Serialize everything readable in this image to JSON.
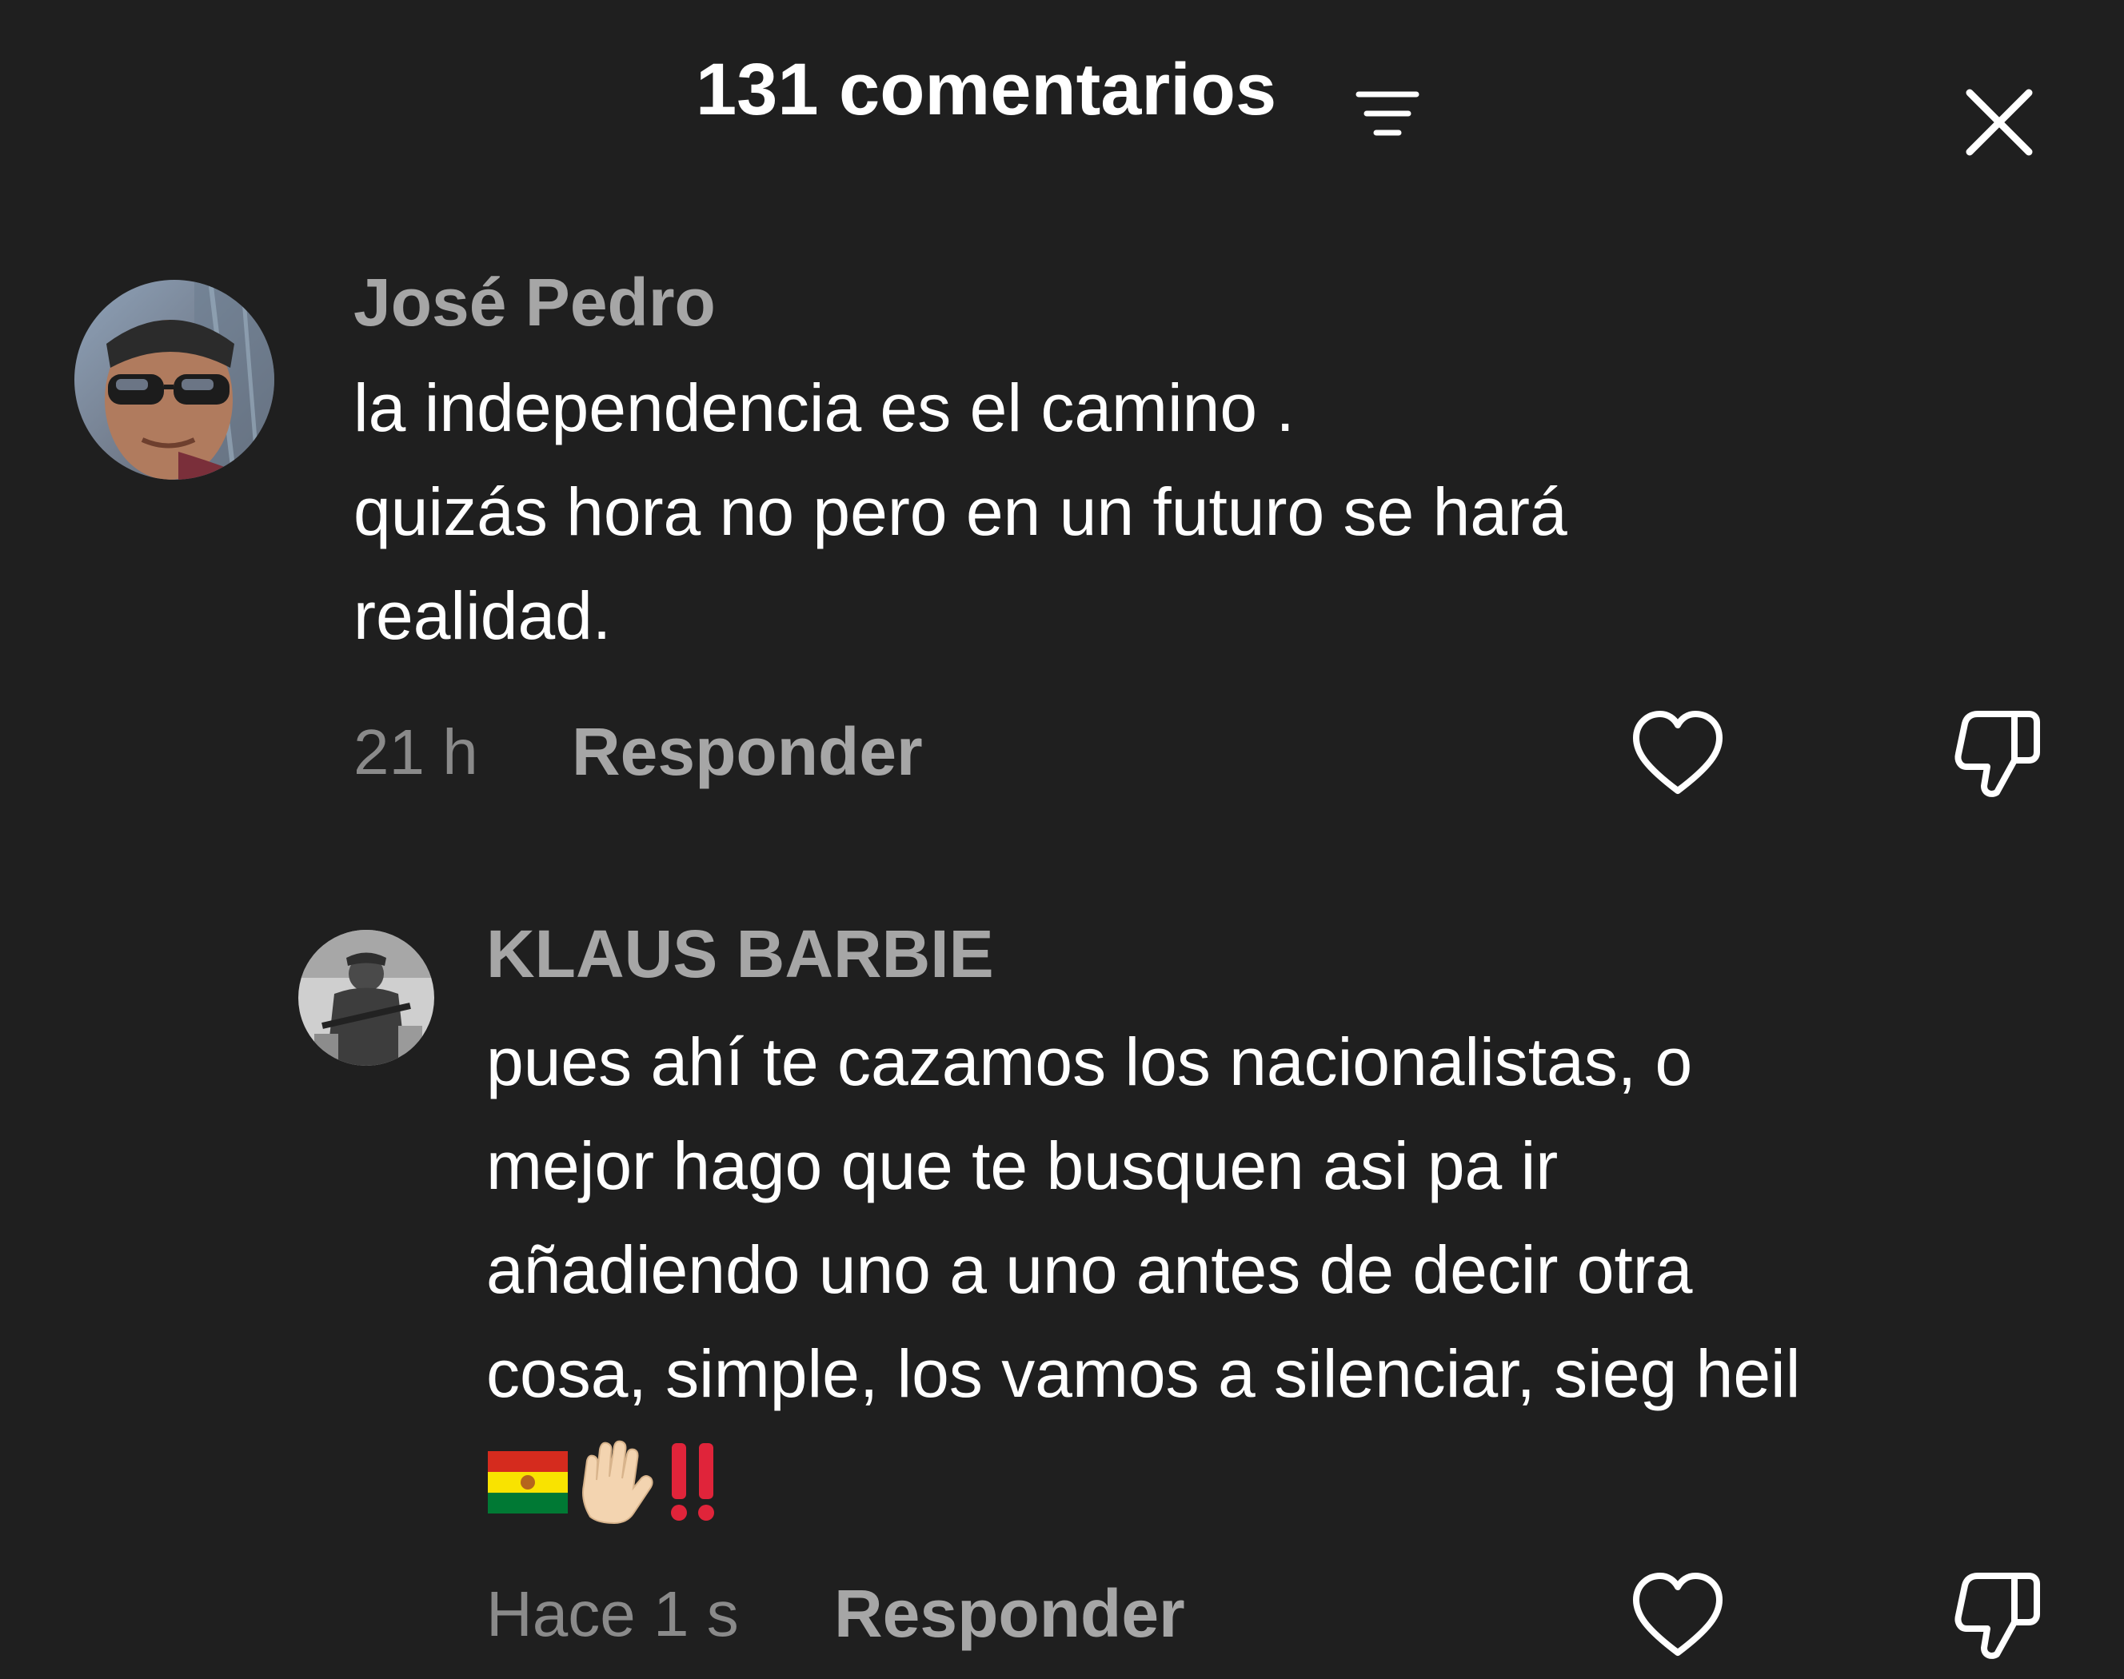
{
  "header": {
    "title": "131 comentarios",
    "sort_icon": "sort-lines-icon",
    "close_icon": "close-x-icon"
  },
  "comments": [
    {
      "username": "José Pedro",
      "text": "la independencia es el camino .\nquizás hora no pero en un futuro se hará\nrealidad.",
      "time": "21 h",
      "reply_label": "Responder",
      "avatar": "user-photo-avatar"
    },
    {
      "username": "KLAUS BARBIE",
      "text": "pues ahí te cazamos los nacionalistas, o\nmejor hago que te busquen asi pa ir\nañadiendo uno a uno antes de decir otra\ncosa, simple, los vamos a silenciar, sieg heil",
      "emojis": [
        "bolivia-flag-emoji",
        "raised-hand-emoji",
        "double-exclamation-emoji"
      ],
      "time": "Hace 1 s",
      "reply_label": "Responder",
      "avatar": "soldier-photo-avatar",
      "is_reply": true
    }
  ],
  "colors": {
    "background": "#1f1f1f",
    "text_primary": "#ffffff",
    "text_secondary": "#a6a6a6",
    "text_muted": "#8a8a8a"
  }
}
